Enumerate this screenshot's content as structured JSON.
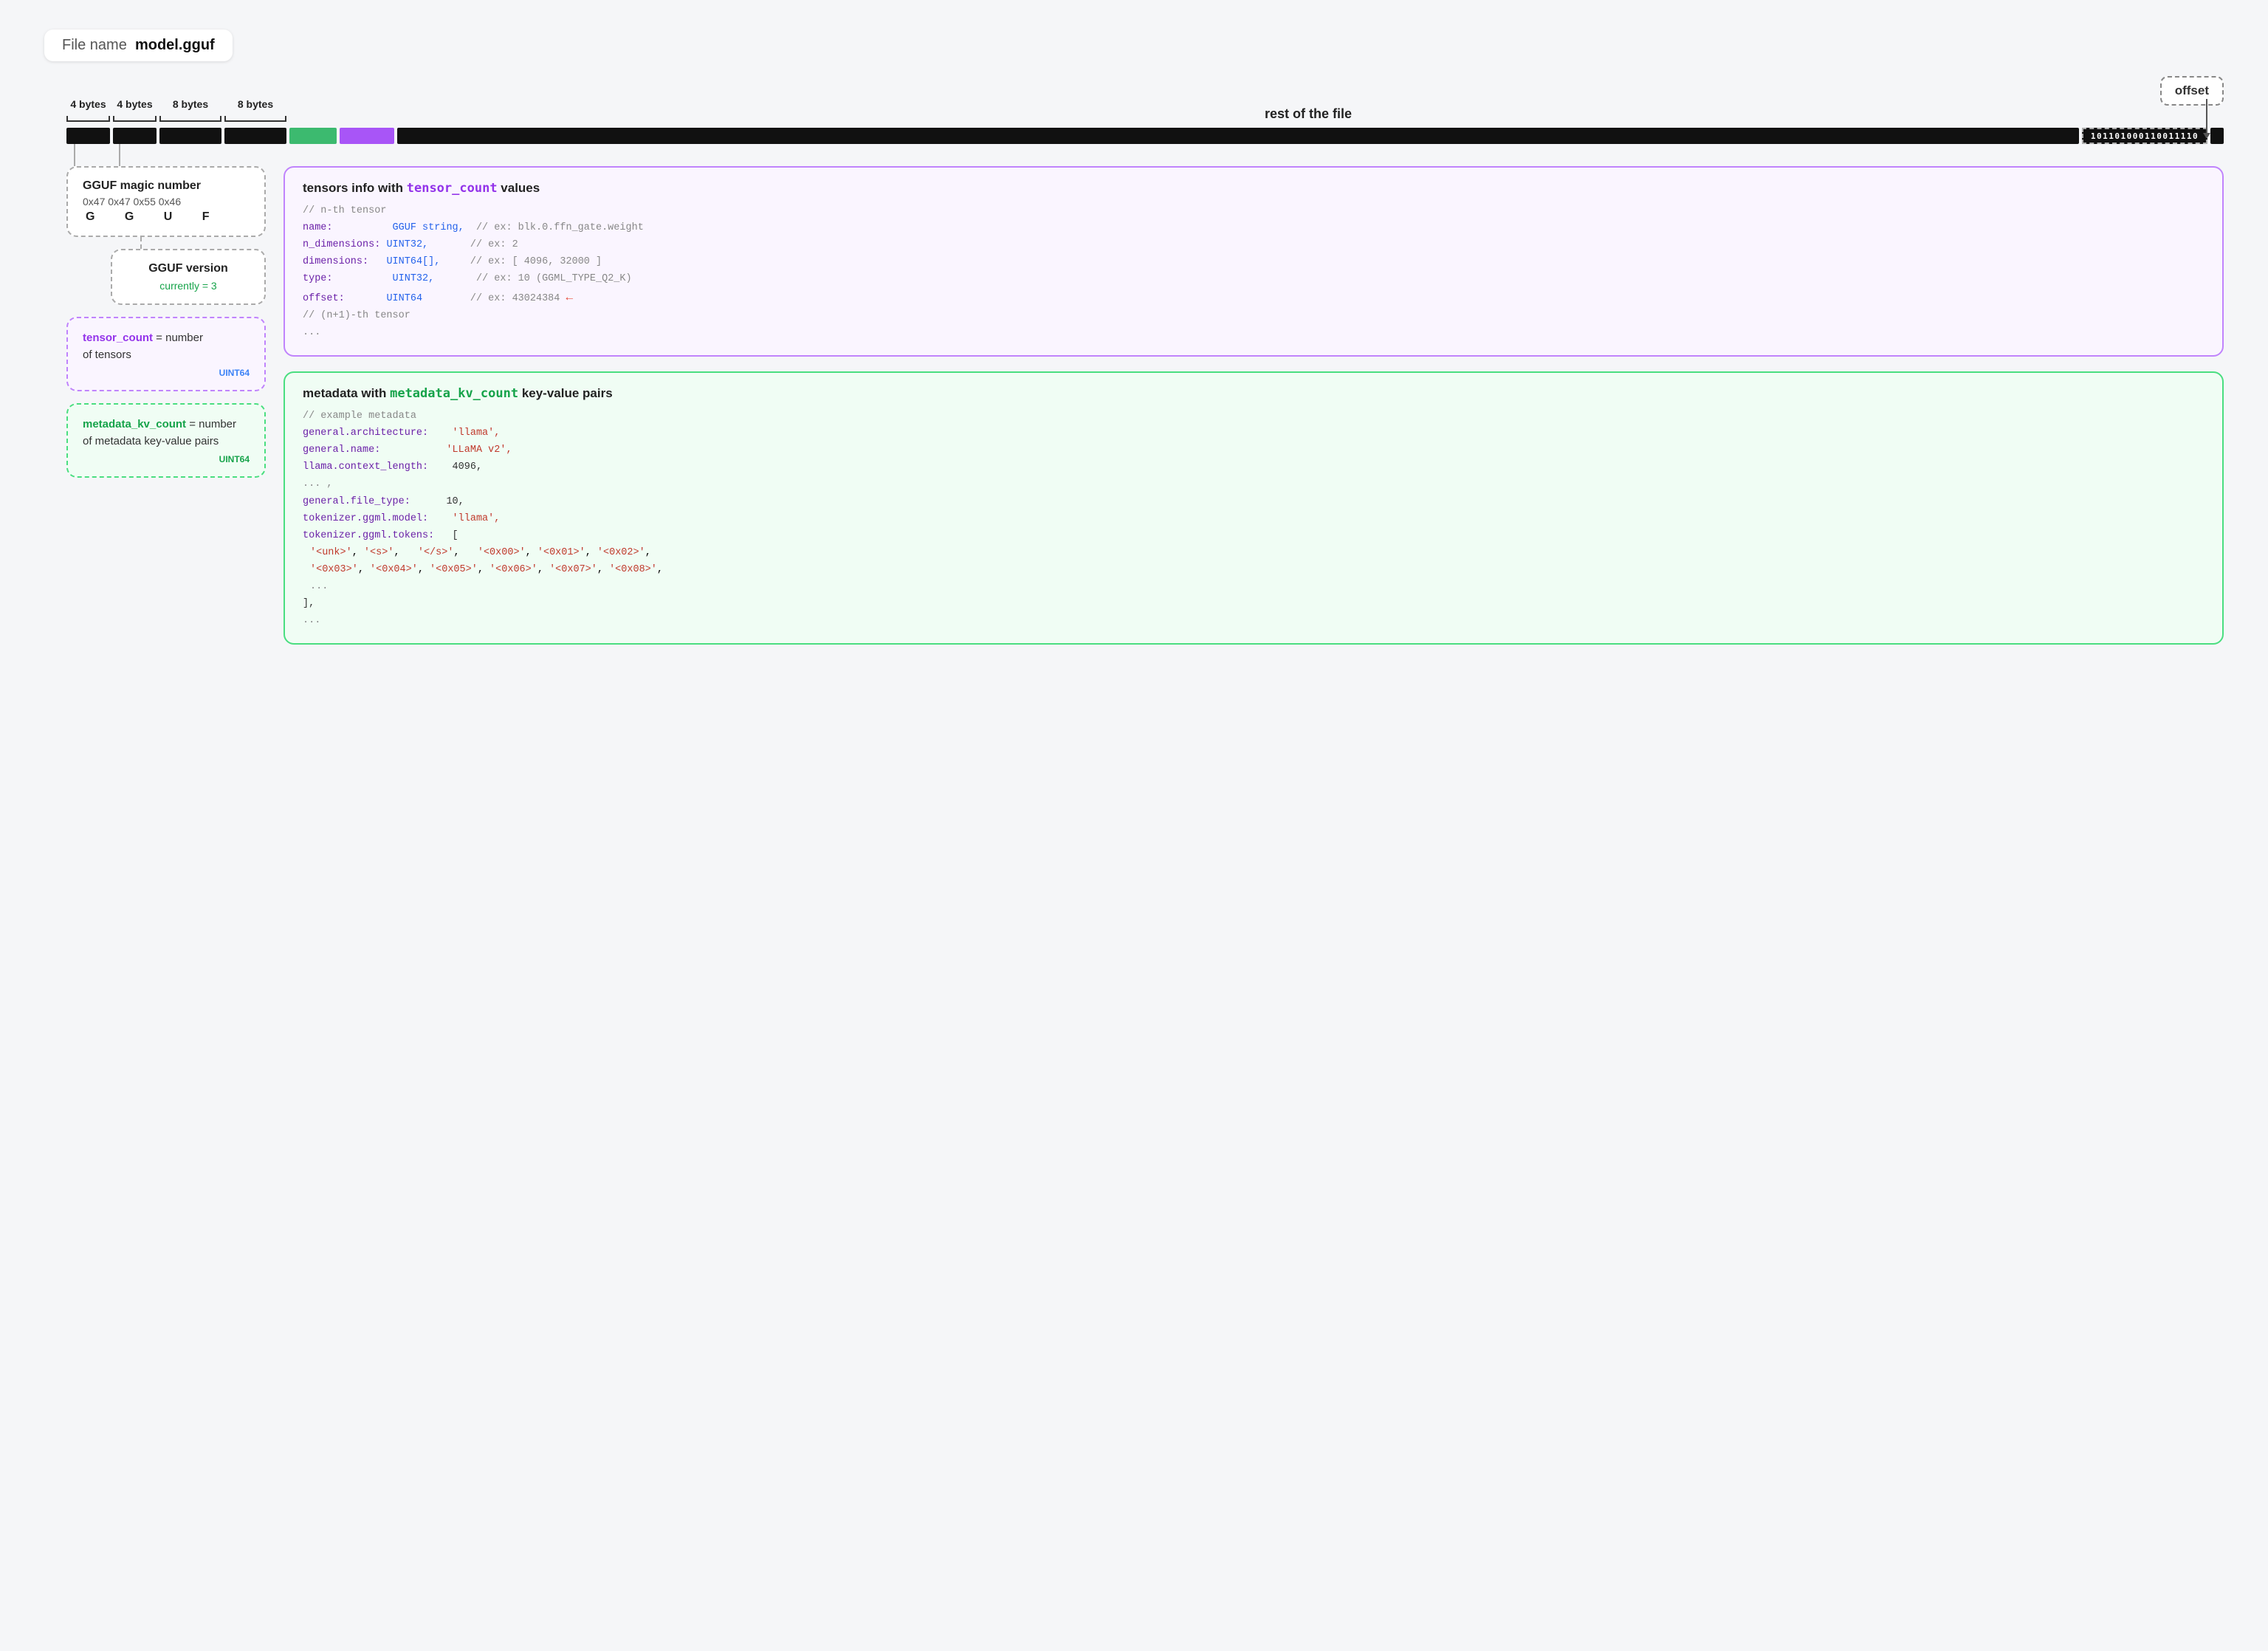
{
  "header": {
    "file_label": "File name",
    "file_name": "model.gguf"
  },
  "bar": {
    "byte_labels": [
      "4 bytes",
      "4 bytes",
      "8 bytes",
      "8 bytes"
    ],
    "rest_label": "rest of the file",
    "binary_text": "101101000110011110",
    "offset_label": "offset"
  },
  "magic_box": {
    "title": "GGUF magic number",
    "hex_values": "0x47  0x47  0x55  0x46",
    "letters": "G    G    U    F"
  },
  "version_box": {
    "title": "GGUF version",
    "subtitle": "currently = 3"
  },
  "tensor_count_box": {
    "text1": "tensor_count",
    "text2": " = number",
    "text3": "of tensors",
    "type": "UINT64"
  },
  "metadata_kv_box": {
    "text1": "metadata_kv_count",
    "text2": " = number",
    "text3": "of metadata key-value pairs",
    "type": "UINT64"
  },
  "tensors_box": {
    "title_prefix": "tensors info with ",
    "title_var": "tensor_count",
    "title_suffix": " values",
    "comment1": "// n-th tensor",
    "fields": [
      {
        "key": "name:",
        "type": "GGUF string,",
        "comment": "// ex: blk.0.ffn_gate.weight"
      },
      {
        "key": "n_dimensions:",
        "type": "UINT32,",
        "comment": "// ex: 2"
      },
      {
        "key": "dimensions:",
        "type": "UINT64[],",
        "comment": "// ex: [ 4096, 32000 ]"
      },
      {
        "key": "type:",
        "type": "UINT32,",
        "comment": "// ex: 10 (GGML_TYPE_Q2_K)"
      },
      {
        "key": "offset:",
        "type": "UINT64",
        "comment": "// ex: 43024384 ←"
      }
    ],
    "comment2": "// (n+1)-th tensor",
    "dots": "..."
  },
  "metadata_box": {
    "title_prefix": "metadata with ",
    "title_var": "metadata_kv_count",
    "title_suffix": " key-value pairs",
    "comment1": "// example metadata",
    "lines": [
      {
        "key": "general.architecture:",
        "value": "'llama',"
      },
      {
        "key": "general.name:",
        "value": "'LLaMA v2',"
      },
      {
        "key": "llama.context_length:",
        "value": "4096,"
      },
      {
        "key": "... ,"
      }
    ],
    "lines2": [
      {
        "key": "general.file_type:",
        "value": "10,"
      },
      {
        "key": "tokenizer.ggml.model:",
        "value": "'llama',"
      },
      {
        "key": "tokenizer.ggml.tokens:",
        "value": "["
      }
    ],
    "token_values": "  '<unk>',  '<s>',   '</s>',   '<0x00>', '<0x01>', '<0x02>',",
    "token_values2": "  '<0x03>', '<0x04>', '<0x05>', '<0x06>', '<0x07>', '<0x08>',",
    "token_dots": "  ...",
    "closing": "],",
    "final_dots": "..."
  }
}
